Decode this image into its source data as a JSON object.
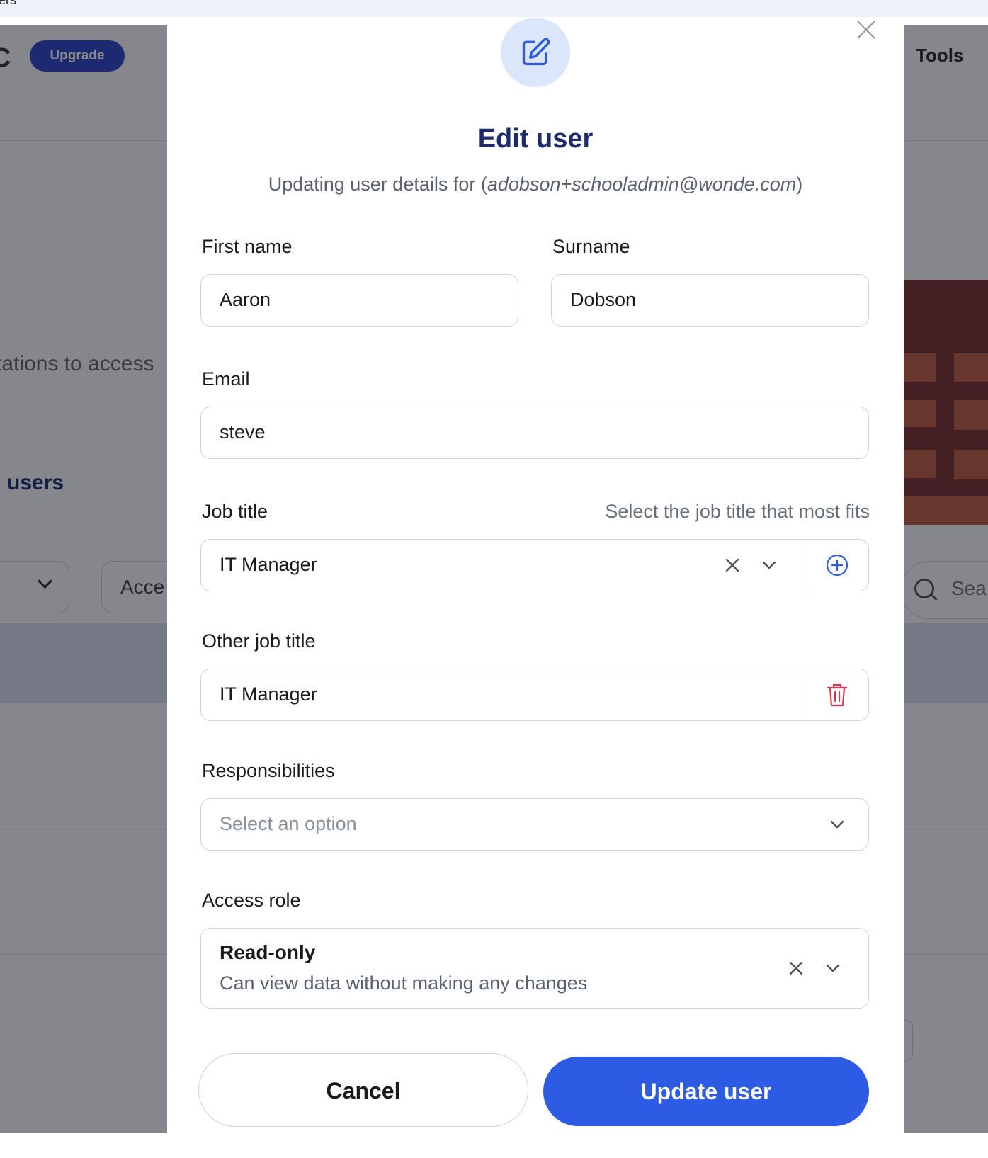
{
  "background": {
    "tab_fragment": "ers",
    "logo_fragment": "C",
    "upgrade_label": "Upgrade",
    "tools_label": "Tools",
    "intro_fragment": "tations to access",
    "users_heading_fragment": "users",
    "filter_fragment": "Acce",
    "search_fragment": "Sea"
  },
  "modal": {
    "title": "Edit user",
    "subtitle_prefix": "Updating user details for (",
    "subtitle_email": "adobson+schooladmin@wonde.com",
    "subtitle_suffix": ")",
    "fields": {
      "first_name": {
        "label": "First name",
        "value": "Aaron"
      },
      "surname": {
        "label": "Surname",
        "value": "Dobson"
      },
      "email": {
        "label": "Email",
        "value": "steve"
      },
      "job_title": {
        "label": "Job title",
        "hint": "Select the job title that most fits",
        "value": "IT Manager"
      },
      "other_job_title": {
        "label": "Other job title",
        "value": "IT Manager"
      },
      "responsibilities": {
        "label": "Responsibilities",
        "placeholder": "Select an option"
      },
      "access_role": {
        "label": "Access role",
        "value_title": "Read-only",
        "value_description": "Can view data without making any changes"
      }
    },
    "buttons": {
      "cancel": "Cancel",
      "submit": "Update user"
    }
  },
  "colors": {
    "primary": "#2d5be3",
    "heading": "#1d2b6b",
    "danger": "#d93a4a",
    "icon_bg": "#dbe6fb"
  }
}
